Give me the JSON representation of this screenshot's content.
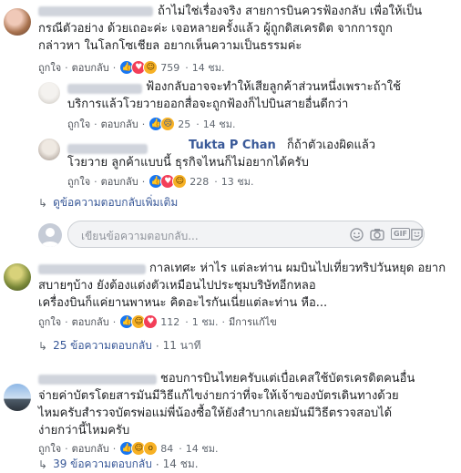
{
  "comments": [
    {
      "lines": [
        "ถ้าไม่ใช่เรื่องจริง สายการบินควรฟ้องกลับ เพื่อให้เป็น",
        "กรณีตัวอย่าง ด้วยเถอะค่ะ เจอหลายครั้งแล้ว ผู้ถูกดิสเครดิต จากการถูก",
        "กล่าวหา ในโลกโซเชียล อยากเห็นความเป็นธรรมค่ะ"
      ],
      "like_label": "ถูกใจ",
      "reply_label": "ตอบกลับ",
      "reaction_count": "759",
      "time": "14 ชม."
    },
    {
      "lines": [
        "ฟ้องกลับอาจจะทำให้เสียลูกค้าส่วนหนึ่งเพราะถ้าใช้",
        "บริการแล้วโวยวายออกสื่อจะถูกฟ้องก็ไปบินสายอื่นดีกว่า"
      ],
      "like_label": "ถูกใจ",
      "reply_label": "ตอบกลับ",
      "reaction_count": "25",
      "time": "14 ชม."
    },
    {
      "name": "Tukta P Chan",
      "lines": [
        "ก็ถ้าตัวเองผิดแล้ว",
        "โวยวาย ลูกค้าแบบนี้ ธุรกิจไหนก็ไม่อยากได้ครับ"
      ],
      "like_label": "ถูกใจ",
      "reply_label": "ตอบกลับ",
      "reaction_count": "228",
      "time": "13 ชม."
    },
    {
      "lines": [
        "กาลเทศะ ห่าไร แต่ละท่าน ผมบินไปเที่ยวทริปวันหยุด อยาก",
        "สบายๆบ้าง ยังต้องแต่งตัวเหมือนไปประชุมบริษัทอีกหลอ",
        "เครื่องบินก็แค่ยานพาหนะ คิดอะไรกันเนี่ยแต่ละท่าน หือ..."
      ],
      "like_label": "ถูกใจ",
      "reply_label": "ตอบกลับ",
      "reaction_count": "112",
      "time": "1 ชม.",
      "edited": "มีการแก้ไข"
    },
    {
      "lines": [
        "ชอบการบินไทยครับแต่เบื่อเคสใช้บัตรเครดิตคนอื่น",
        "จ่ายค่าบัตรโดยสารมันมีวิธีแก้ไขง่ายกว่าที่จะให้เจ้าของบัตรเดินทางด้วย",
        "ไหมครับสำรวจบัตรพ่อแม่พี่น้องซื้อให้ยังสำบากเลยมันมีวิธีตรวจสอบได้",
        "ง่ายกว่านี้ไหมครับ"
      ],
      "like_label": "ถูกใจ",
      "reply_label": "ตอบกลับ",
      "reaction_count": "84",
      "time": "14 ชม."
    }
  ],
  "more_replies": {
    "label": "ดูข้อความตอบกลับเพิ่มเติม"
  },
  "reply_threads": [
    {
      "label": "25 ข้อความตอบกลับ",
      "time": "11 นาที"
    },
    {
      "label": "39 ข้อความตอบกลับ",
      "time": "14 ชม."
    }
  ],
  "reply_box": {
    "placeholder": "เขียนข้อความตอบกลับ...",
    "gif_label": "GIF"
  },
  "colors": {
    "link": "#385898",
    "muted": "#606770",
    "like": "#1877f2",
    "love": "#f33e58",
    "haha": "#f7b125"
  }
}
